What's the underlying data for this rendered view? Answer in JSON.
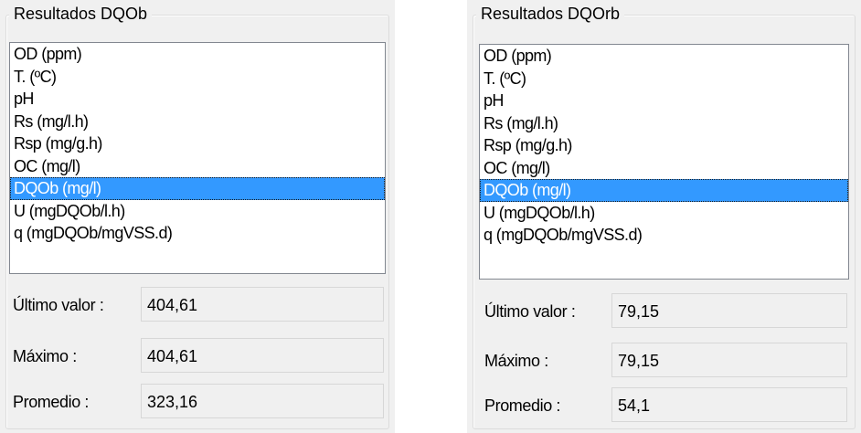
{
  "left_panel": {
    "title": "Resultados DQOb",
    "list_items": [
      "OD (ppm)",
      "T. (ºC)",
      "pH",
      "Rs (mg/l.h)",
      "Rsp (mg/g.h)",
      "OC (mg/l)",
      "DQOb (mg/l)",
      "U (mgDQOb/l.h)",
      "q (mgDQOb/mgVSS.d)"
    ],
    "selected_item": "DQOb (mg/l)",
    "stats": {
      "last_label": "Último valor :",
      "last_value": "404,61",
      "max_label": "Máximo :",
      "max_value": "404,61",
      "avg_label": "Promedio :",
      "avg_value": "323,16"
    }
  },
  "right_panel": {
    "title": "Resultados DQOrb",
    "list_items": [
      "OD (ppm)",
      "T. (ºC)",
      "pH",
      "Rs (mg/l.h)",
      "Rsp (mg/g.h)",
      "OC (mg/l)",
      "DQOb (mg/l)",
      "U (mgDQOb/l.h)",
      "q (mgDQOb/mgVSS.d)"
    ],
    "selected_item": "DQOb (mg/l)",
    "stats": {
      "last_label": "Último valor :",
      "last_value": "79,15",
      "max_label": "Máximo :",
      "max_value": "79,15",
      "avg_label": "Promedio :",
      "avg_value": "54,1"
    }
  },
  "colors": {
    "selection_background": "#3399ff",
    "selection_text": "#ffffff",
    "panel_background": "#f0f0f0",
    "list_border": "#828790"
  }
}
